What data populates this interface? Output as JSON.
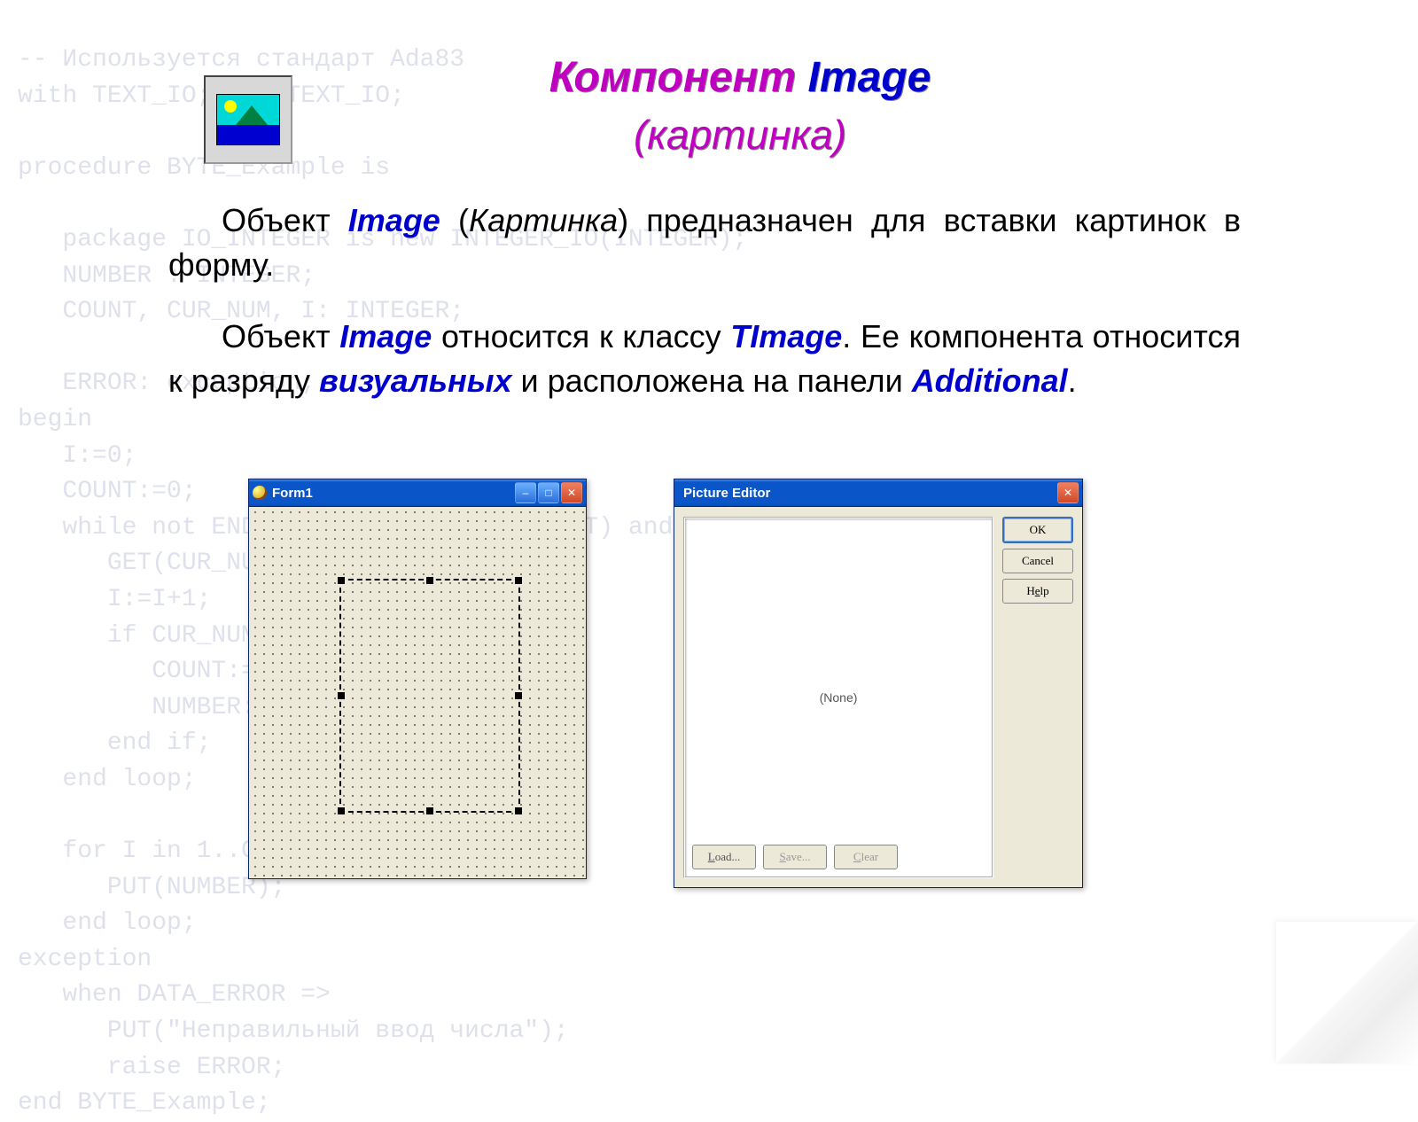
{
  "background_code": "-- Используется стандарт Ada83\nwith TEXT_IO; use TEXT_IO;\n\nprocedure BYTE_Example is\n\n   package IO_INTEGER is new INTEGER_IO(INTEGER);\n   NUMBER : INTEGER;\n   COUNT, CUR_NUM, I: INTEGER;\n\n   ERROR: exception;\nbegin\n   I:=0;\n   COUNT:=0;\n   while not END_OF_FILE(STANDARD_INPUT) and I<=10 loop\n      GET(CUR_NUM);\n      I:=I+1;\n      if CUR_NUM mod 2 =0 then\n         COUNT:=COUNT+1;\n         NUMBER:=NUMBER+CUR_NUM;\n      end if;\n   end loop;\n\n   for I in 1..COUNT loop\n      PUT(NUMBER);\n   end loop;\nexception\n   when DATA_ERROR =>\n      PUT(\"Неправильный ввод числа\");\n      raise ERROR;\nend BYTE_Example;",
  "title": {
    "part1": "Компонент ",
    "part2": "Image"
  },
  "subtitle": "(картинка)",
  "para1": {
    "t1": "Объект ",
    "kw1": "Image",
    "t2": " (",
    "it1": "Картинка",
    "t3": ") предназначен для вставки картинок в форму."
  },
  "para2": {
    "t1": "Объект ",
    "kw1": "Image",
    "t2": " относится к классу ",
    "kw2": "TImage",
    "t3": ". Ее компонента относится к разряду ",
    "kw3": "визуальных",
    "t4": " и расположена на панели ",
    "kw4": "Additional",
    "t5": "."
  },
  "form1": {
    "title": "Form1",
    "btn_min": "‒",
    "btn_max": "□",
    "btn_close": "✕"
  },
  "piceditor": {
    "title": "Picture Editor",
    "btn_close": "✕",
    "preview_text": "(None)",
    "ok": "OK",
    "cancel": "Cancel",
    "help_pre": "H",
    "help_u": "e",
    "help_post": "lp",
    "load_u": "L",
    "load_post": "oad...",
    "save_u": "S",
    "save_post": "ave...",
    "clear_pre": "",
    "clear_u": "C",
    "clear_post": "lear"
  }
}
